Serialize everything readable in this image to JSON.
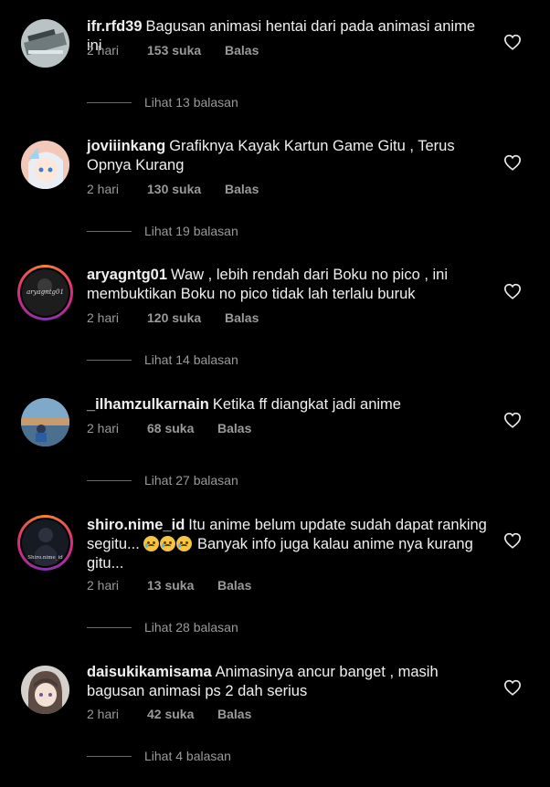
{
  "comments": [
    {
      "user": "ifr.rfd39",
      "text": "Bagusan animasi hentai dari pada animasi anime ini",
      "time": "2 hari",
      "likes": "153 suka",
      "reply": "Balas",
      "view_replies": "Lihat 13 balasan"
    },
    {
      "user": "joviiinkang",
      "text": "Grafiknya Kayak Kartun Game Gitu , Terus Opnya Kurang",
      "time": "2 hari",
      "likes": "130 suka",
      "reply": "Balas",
      "view_replies": "Lihat 19 balasan"
    },
    {
      "user": "aryagntg01",
      "text": "Waw , lebih rendah dari Boku no pico , ini membuktikan Boku no pico tidak lah terlalu buruk",
      "time": "2 hari",
      "likes": "120 suka",
      "reply": "Balas",
      "view_replies": "Lihat 14 balasan",
      "avatar_label": "aryagntg01"
    },
    {
      "user": "_ilhamzulkarnain",
      "text": "Ketika ff diangkat jadi anime",
      "time": "2 hari",
      "likes": "68 suka",
      "reply": "Balas",
      "view_replies": "Lihat 27 balasan"
    },
    {
      "user": "shiro.nime_id",
      "text_a": "Itu anime belum update sudah dapat ranking segitu...",
      "text_b": "Banyak info juga kalau anime nya kurang gitu...",
      "time": "2 hari",
      "likes": "13 suka",
      "reply": "Balas",
      "view_replies": "Lihat 28 balasan",
      "avatar_label": "Shiro.nime_id"
    },
    {
      "user": "daisukikamisama",
      "text": "Animasinya ancur banget , masih bagusan animasi ps 2 dah serius",
      "time": "2 hari",
      "likes": "42 suka",
      "reply": "Balas",
      "view_replies": "Lihat 4 balasan"
    }
  ],
  "icons": {
    "like": "heart-outline-icon",
    "emoji": "crying-face-icon"
  },
  "colors": {
    "background": "#000000",
    "text": "#f0f0f0",
    "secondary": "#9a9a9a",
    "story_ring": "#dd2a7b"
  }
}
